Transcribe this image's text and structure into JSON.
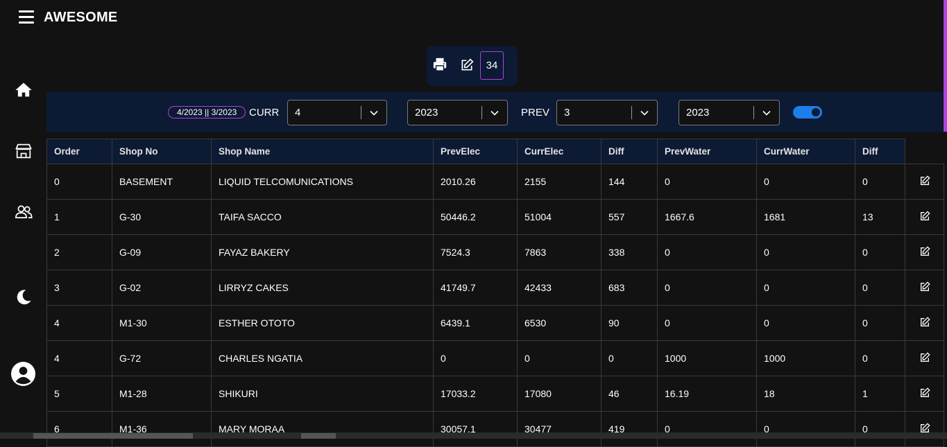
{
  "app": {
    "title": "AWESOME"
  },
  "sidebar": {
    "items": [
      {
        "icon": "home-icon"
      },
      {
        "icon": "store-icon"
      },
      {
        "icon": "users-icon"
      },
      {
        "icon": "moon-icon"
      },
      {
        "icon": "avatar-icon"
      }
    ]
  },
  "toolbox": {
    "count": "34"
  },
  "filters": {
    "period_badge": "4/2023 || 3/2023",
    "curr_label": "CURR",
    "curr_month": "4",
    "curr_year": "2023",
    "prev_label": "PREV",
    "prev_month": "3",
    "prev_year": "2023",
    "toggle_on": true
  },
  "table": {
    "headers": [
      "Order",
      "Shop No",
      "Shop Name",
      "PrevElec",
      "CurrElec",
      "Diff",
      "PrevWater",
      "CurrWater",
      "Diff"
    ],
    "rows": [
      [
        "0",
        "BASEMENT",
        "LIQUID TELCOMUNICATIONS",
        "2010.26",
        "2155",
        "144",
        "0",
        "0",
        "0"
      ],
      [
        "1",
        "G-30",
        "TAIFA SACCO",
        "50446.2",
        "51004",
        "557",
        "1667.6",
        "1681",
        "13"
      ],
      [
        "2",
        "G-09",
        "FAYAZ BAKERY",
        "7524.3",
        "7863",
        "338",
        "0",
        "0",
        "0"
      ],
      [
        "3",
        "G-02",
        "LIRRYZ CAKES",
        "41749.7",
        "42433",
        "683",
        "0",
        "0",
        "0"
      ],
      [
        "4",
        "M1-30",
        "ESTHER OTOTO",
        "6439.1",
        "6530",
        "90",
        "0",
        "0",
        "0"
      ],
      [
        "4",
        "G-72",
        "CHARLES NGATIA",
        "0",
        "0",
        "0",
        "1000",
        "1000",
        "0"
      ],
      [
        "5",
        "M1-28",
        "SHIKURI",
        "17033.2",
        "17080",
        "46",
        "16.19",
        "18",
        "1"
      ],
      [
        "6",
        "M1-36",
        "MARY MORAA",
        "30057.1",
        "30477",
        "419",
        "0",
        "0",
        "0"
      ]
    ]
  },
  "colors": {
    "accent": "#b341e0",
    "panel": "#0c1a33",
    "toggle": "#1e7ee8",
    "background": "#121212"
  }
}
